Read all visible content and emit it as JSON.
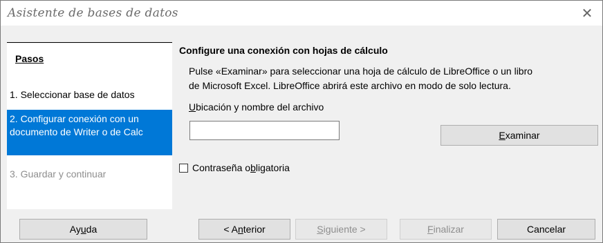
{
  "window": {
    "title": "Asistente de bases de datos",
    "close_glyph": "✕"
  },
  "steps": {
    "heading": "Pasos",
    "items": [
      {
        "label": "1. Seleccionar base de datos",
        "state": "done"
      },
      {
        "label": "2. Configurar conexión con un documento de Writer o de Calc",
        "state": "current"
      },
      {
        "label": "3. Guardar y continuar",
        "state": "disabled"
      }
    ]
  },
  "content": {
    "section_title": "Configure una conexión con hojas de cálculo",
    "description_line1": "Pulse «Examinar» para seleccionar una hoja de cálculo de LibreOffice o un libro",
    "description_line2": "de Microsoft Excel. LibreOffice abrirá este archivo en modo de solo lectura.",
    "location_label": {
      "accel": "U",
      "rest": "bicación y nombre del archivo"
    },
    "location_value": "",
    "browse_button": {
      "accel": "E",
      "rest": "xaminar"
    },
    "password_checkbox": {
      "pre": "Contraseña o",
      "accel": "b",
      "post": "ligatoria",
      "checked": false
    }
  },
  "footer": {
    "help": {
      "pre": "Ay",
      "accel": "u",
      "post": "da"
    },
    "back": {
      "pre": "< A",
      "accel": "n",
      "post": "terior"
    },
    "next": {
      "pre": "",
      "accel": "S",
      "post": "iguiente >"
    },
    "finish": {
      "pre": "",
      "accel": "F",
      "post": "inalizar"
    },
    "cancel": "Cancelar"
  },
  "colors": {
    "selection": "#0078d7",
    "disabled_text": "#8e8e8e"
  }
}
